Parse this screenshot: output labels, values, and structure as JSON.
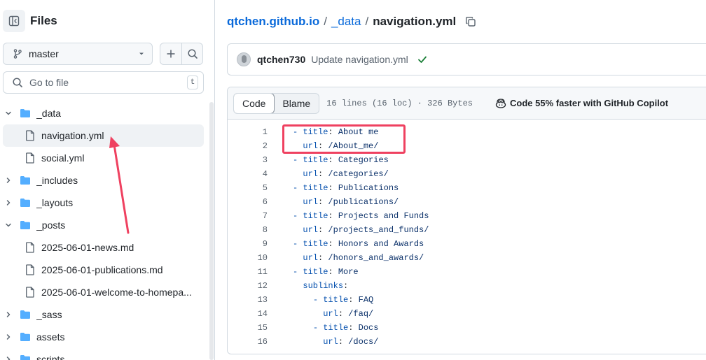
{
  "sidebar": {
    "title": "Files",
    "branch": "master",
    "goto_placeholder": "Go to file",
    "goto_shortcut": "t",
    "tree": [
      {
        "label": "_data",
        "type": "folder",
        "level": 0,
        "open": true
      },
      {
        "label": "navigation.yml",
        "type": "file",
        "level": 1,
        "selected": true
      },
      {
        "label": "social.yml",
        "type": "file",
        "level": 1
      },
      {
        "label": "_includes",
        "type": "folder",
        "level": 0,
        "open": false
      },
      {
        "label": "_layouts",
        "type": "folder",
        "level": 0,
        "open": false
      },
      {
        "label": "_posts",
        "type": "folder",
        "level": 0,
        "open": true
      },
      {
        "label": "2025-06-01-news.md",
        "type": "file",
        "level": 1
      },
      {
        "label": "2025-06-01-publications.md",
        "type": "file",
        "level": 1
      },
      {
        "label": "2025-06-01-welcome-to-homepa...",
        "type": "file",
        "level": 1
      },
      {
        "label": "_sass",
        "type": "folder",
        "level": 0,
        "open": false
      },
      {
        "label": "assets",
        "type": "folder",
        "level": 0,
        "open": false
      },
      {
        "label": "scripts",
        "type": "folder",
        "level": 0,
        "open": false
      }
    ]
  },
  "breadcrumb": {
    "repo": "qtchen.github.io",
    "sep": "/",
    "folder": "_data",
    "file": "navigation.yml"
  },
  "commit": {
    "author": "qtchen730",
    "message": "Update navigation.yml"
  },
  "file": {
    "tab_code": "Code",
    "tab_blame": "Blame",
    "meta": "16 lines (16 loc) · 326 Bytes",
    "copilot": "Code 55% faster with GitHub Copilot",
    "lines": [
      {
        "n": "1",
        "indent": "",
        "dash": "- ",
        "key": "title",
        "value": "About me"
      },
      {
        "n": "2",
        "indent": "  ",
        "dash": "",
        "key": "url",
        "value": "/About_me/"
      },
      {
        "n": "3",
        "indent": "",
        "dash": "- ",
        "key": "title",
        "value": "Categories"
      },
      {
        "n": "4",
        "indent": "  ",
        "dash": "",
        "key": "url",
        "value": "/categories/"
      },
      {
        "n": "5",
        "indent": "",
        "dash": "- ",
        "key": "title",
        "value": "Publications"
      },
      {
        "n": "6",
        "indent": "  ",
        "dash": "",
        "key": "url",
        "value": "/publications/"
      },
      {
        "n": "7",
        "indent": "",
        "dash": "- ",
        "key": "title",
        "value": "Projects and Funds"
      },
      {
        "n": "8",
        "indent": "  ",
        "dash": "",
        "key": "url",
        "value": "/projects_and_funds/"
      },
      {
        "n": "9",
        "indent": "",
        "dash": "- ",
        "key": "title",
        "value": "Honors and Awards"
      },
      {
        "n": "10",
        "indent": "  ",
        "dash": "",
        "key": "url",
        "value": "/honors_and_awards/"
      },
      {
        "n": "11",
        "indent": "",
        "dash": "- ",
        "key": "title",
        "value": "More"
      },
      {
        "n": "12",
        "indent": "  ",
        "dash": "",
        "key": "sublinks",
        "value": ""
      },
      {
        "n": "13",
        "indent": "    ",
        "dash": "- ",
        "key": "title",
        "value": "FAQ"
      },
      {
        "n": "14",
        "indent": "      ",
        "dash": "",
        "key": "url",
        "value": "/faq/"
      },
      {
        "n": "15",
        "indent": "    ",
        "dash": "- ",
        "key": "title",
        "value": "Docs"
      },
      {
        "n": "16",
        "indent": "      ",
        "dash": "",
        "key": "url",
        "value": "/docs/"
      }
    ]
  },
  "colors": {
    "link": "#0969da",
    "annotation": "#ef4160",
    "success": "#1a7f37",
    "key": "#0550ae",
    "value": "#0a3069"
  }
}
